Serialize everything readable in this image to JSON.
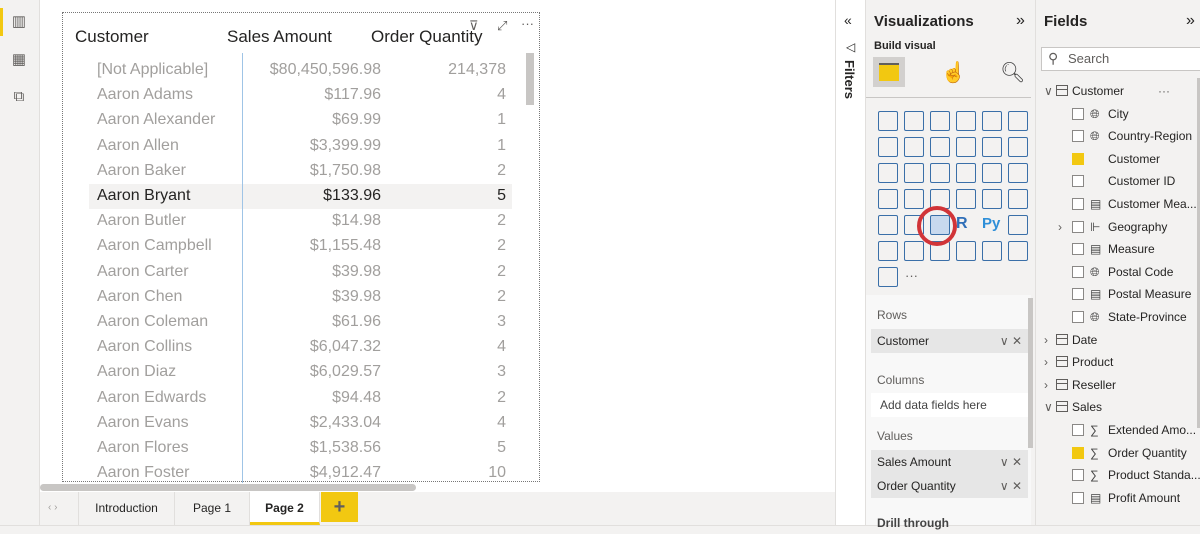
{
  "table": {
    "headers": [
      "Customer",
      "Sales Amount",
      "Order Quantity"
    ],
    "rows": [
      [
        "[Not Applicable]",
        "$80,450,596.98",
        "214,378"
      ],
      [
        "Aaron Adams",
        "$117.96",
        "4"
      ],
      [
        "Aaron Alexander",
        "$69.99",
        "1"
      ],
      [
        "Aaron Allen",
        "$3,399.99",
        "1"
      ],
      [
        "Aaron Baker",
        "$1,750.98",
        "2"
      ],
      [
        "Aaron Bryant",
        "$133.96",
        "5"
      ],
      [
        "Aaron Butler",
        "$14.98",
        "2"
      ],
      [
        "Aaron Campbell",
        "$1,155.48",
        "2"
      ],
      [
        "Aaron Carter",
        "$39.98",
        "2"
      ],
      [
        "Aaron Chen",
        "$39.98",
        "2"
      ],
      [
        "Aaron Coleman",
        "$61.96",
        "3"
      ],
      [
        "Aaron Collins",
        "$6,047.32",
        "4"
      ],
      [
        "Aaron Diaz",
        "$6,029.57",
        "3"
      ],
      [
        "Aaron Edwards",
        "$94.48",
        "2"
      ],
      [
        "Aaron Evans",
        "$2,433.04",
        "4"
      ],
      [
        "Aaron Flores",
        "$1,538.56",
        "5"
      ],
      [
        "Aaron Foster",
        "$4,912.47",
        "10"
      ]
    ],
    "selected_row": 5
  },
  "tabs": [
    "Introduction",
    "Page 1",
    "Page 2"
  ],
  "add_tab": "+",
  "active_tab": "Page 2",
  "filters_label": "Filters",
  "viz": {
    "title": "Visualizations",
    "build": "Build visual",
    "rows_label": "Rows",
    "rows": [
      "Customer"
    ],
    "columns_label": "Columns",
    "columns_placeholder": "Add data fields here",
    "values_label": "Values",
    "values": [
      "Sales Amount",
      "Order Quantity"
    ],
    "drill": "Drill through",
    "more": "···",
    "highlight_color": "#d13438"
  },
  "fields": {
    "title": "Fields",
    "search_placeholder": "Search",
    "items": [
      {
        "label": "Customer",
        "type": "table",
        "expanded": true,
        "level": 0
      },
      {
        "label": "City",
        "icon": "globe-icon",
        "checked": false,
        "level": 1
      },
      {
        "label": "Country-Region",
        "icon": "globe-icon",
        "checked": false,
        "level": 1
      },
      {
        "label": "Customer",
        "icon": "",
        "checked": true,
        "level": 1
      },
      {
        "label": "Customer ID",
        "icon": "",
        "checked": false,
        "level": 1
      },
      {
        "label": "Customer Mea...",
        "icon": "calculator-icon",
        "checked": false,
        "level": 1
      },
      {
        "label": "Geography",
        "icon": "hierarchy-icon",
        "checked": false,
        "level": 1
      },
      {
        "label": "Measure",
        "icon": "calculator-icon",
        "checked": false,
        "level": 1
      },
      {
        "label": "Postal Code",
        "icon": "globe-icon",
        "checked": false,
        "level": 1
      },
      {
        "label": "Postal Measure",
        "icon": "calculator-icon",
        "checked": false,
        "level": 1
      },
      {
        "label": "State-Province",
        "icon": "globe-icon",
        "checked": false,
        "level": 1
      },
      {
        "label": "Date",
        "type": "table",
        "expanded": false,
        "level": 0
      },
      {
        "label": "Product",
        "type": "table",
        "expanded": false,
        "level": 0
      },
      {
        "label": "Reseller",
        "type": "table",
        "expanded": false,
        "level": 0
      },
      {
        "label": "Sales",
        "type": "table",
        "expanded": true,
        "level": 0
      },
      {
        "label": "Extended Amo...",
        "icon": "sigma-icon",
        "checked": false,
        "level": 1
      },
      {
        "label": "Order Quantity",
        "icon": "sigma-icon",
        "checked": true,
        "level": 1
      },
      {
        "label": "Product Standa...",
        "icon": "sigma-icon",
        "checked": false,
        "level": 1
      },
      {
        "label": "Profit Amount",
        "icon": "calculator-icon",
        "checked": false,
        "level": 1
      }
    ]
  },
  "accent": "#f2c811"
}
